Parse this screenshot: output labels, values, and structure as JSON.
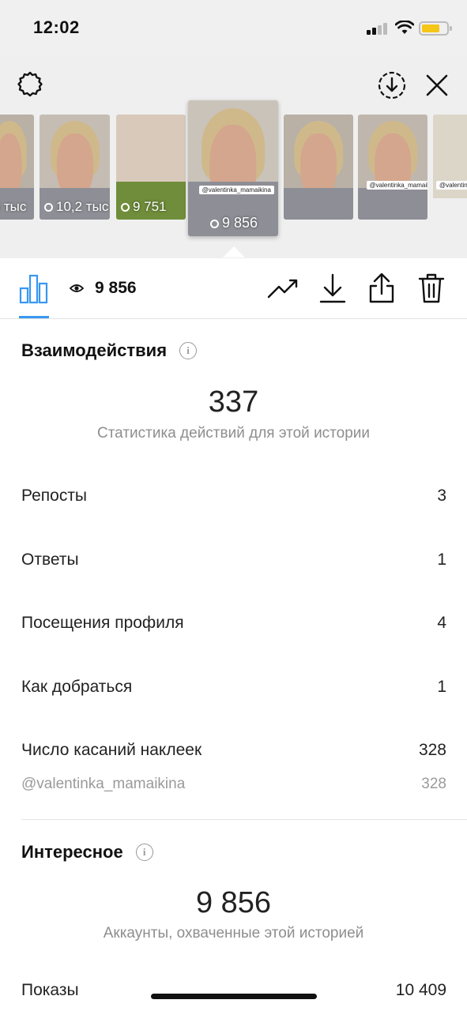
{
  "status_bar": {
    "time": "12:02"
  },
  "stories": [
    {
      "caption": ",6 тыс"
    },
    {
      "caption": "10,2 тыс"
    },
    {
      "caption": "9 751"
    },
    {
      "caption": "9 856",
      "tag": "@valentinka_mamaikina"
    },
    {
      "caption": "",
      "tag": ""
    },
    {
      "caption": "",
      "tag": "@valentinka_mamaikina"
    },
    {
      "caption": "",
      "tag": "@valentinka"
    }
  ],
  "toolbar": {
    "views": "9 856"
  },
  "interactions": {
    "title": "Взаимодействия",
    "total": "337",
    "description": "Статистика действий для этой истории",
    "rows": [
      {
        "label": "Репосты",
        "value": "3"
      },
      {
        "label": "Ответы",
        "value": "1"
      },
      {
        "label": "Посещения профиля",
        "value": "4"
      },
      {
        "label": "Как добраться",
        "value": "1"
      },
      {
        "label": "Число касаний наклеек",
        "value": "328"
      }
    ],
    "sub_row": {
      "label": "@valentinka_mamaikina",
      "value": "328"
    }
  },
  "discovery": {
    "title": "Интересное",
    "total": "9 856",
    "description": "Аккаунты, охваченные этой историей",
    "rows": [
      {
        "label": "Показы",
        "value": "10 409"
      }
    ]
  },
  "colors": {
    "accent": "#3897f0",
    "battery": "#f5c518",
    "muted": "#8e8e8e"
  },
  "icons": [
    "settings-icon",
    "save-icon",
    "close-icon",
    "bar-chart-icon",
    "eye-icon",
    "trend-icon",
    "download-icon",
    "share-icon",
    "trash-icon",
    "info-icon"
  ]
}
